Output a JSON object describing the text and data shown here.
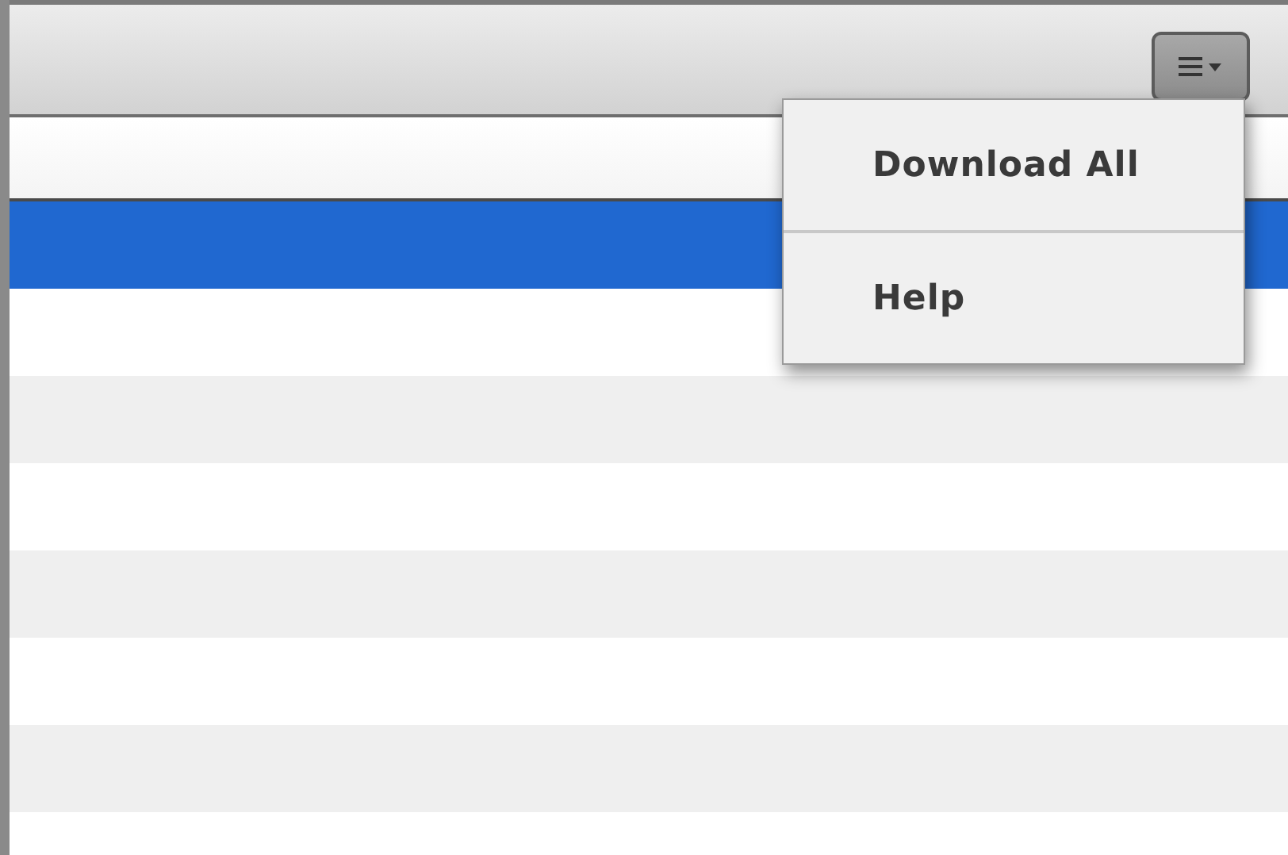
{
  "toolbar": {
    "menu_button": {
      "expanded": true
    }
  },
  "menu": {
    "items": [
      {
        "label": "Download All"
      },
      {
        "label": "Help"
      }
    ]
  },
  "list": {
    "rows": [
      {
        "selected": true
      },
      {
        "selected": false
      },
      {
        "selected": false
      },
      {
        "selected": false
      },
      {
        "selected": false
      },
      {
        "selected": false
      },
      {
        "selected": false
      },
      {
        "selected": false
      }
    ]
  }
}
